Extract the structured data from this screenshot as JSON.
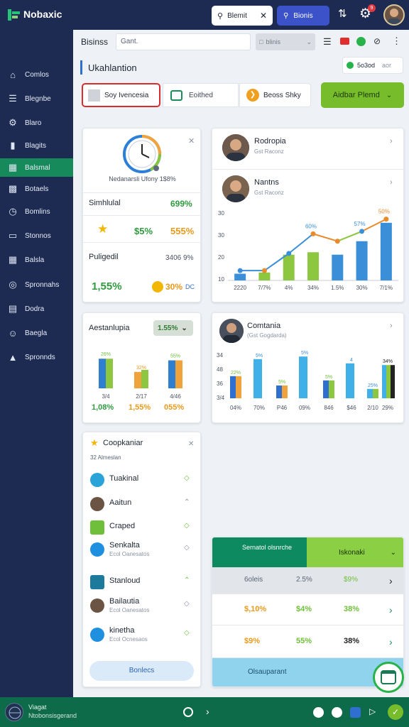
{
  "topbar": {
    "logo": "Nobaxic",
    "search_label": "Blemit",
    "blue_button": "Bionis",
    "notif_count": "9"
  },
  "sidebar": {
    "items": [
      {
        "label": "Comlos",
        "icon": "home-icon"
      },
      {
        "label": "Blegnbe",
        "icon": "menu-icon"
      },
      {
        "label": "Blaro",
        "icon": "gear-icon"
      },
      {
        "label": "Blagits",
        "icon": "chart-icon"
      },
      {
        "label": "Balsmal",
        "icon": "dashboard-icon"
      },
      {
        "label": "Botaels",
        "icon": "calendar-icon"
      },
      {
        "label": "Bomlins",
        "icon": "clock-icon"
      },
      {
        "label": "Stonnos",
        "icon": "book-icon"
      },
      {
        "label": "Balsla",
        "icon": "grid-icon"
      },
      {
        "label": "Spronnahs",
        "icon": "target-icon"
      },
      {
        "label": "Dodra",
        "icon": "doc-icon"
      },
      {
        "label": "Baegla",
        "icon": "person-icon"
      },
      {
        "label": "Spronnds",
        "icon": "hat-icon"
      }
    ]
  },
  "toolbar": {
    "title": "Bisinss",
    "search_placeholder": "Gant.",
    "dropdown_value": "blinis"
  },
  "section": {
    "title": "Ukahlantion",
    "pill_label": "5o3od",
    "pill_suffix": "aor",
    "chip1": "Soy Ivencesia",
    "chip2": "Eoithed",
    "chip3": "Beoss Shky",
    "primary_button": "Aidbar Plemd"
  },
  "card_summary": {
    "subtitle": "Nedanarsli Ufony 1$8%",
    "row1_label": "Simhlulal",
    "row1_value": "699%",
    "row2_value_a": "$5%",
    "row2_value_b": "555%",
    "row3_label": "Puligedil",
    "row3_value": "3406 9%",
    "row4_value_a": "1,55%",
    "row4_value_b": "30%",
    "row4_suffix": "DC"
  },
  "card_people": {
    "person1_name": "Rodropia",
    "person1_sub": "Gst Raconz",
    "person2_name": "Nantns",
    "person2_sub": "Gst Raconz"
  },
  "card_bars_small": {
    "title": "Aestanlupia",
    "badge": "1.55%",
    "footer": [
      "1,08%",
      "1,55%",
      "055%"
    ]
  },
  "card_comp": {
    "name": "Comtania",
    "sub": "(Gst Gogdarda)"
  },
  "card_list": {
    "title": "Coopkaniar",
    "subtitle": "32 Almeslan",
    "items": [
      {
        "name": "Tuakinal",
        "sub": "",
        "icon": "puzzle-icon"
      },
      {
        "name": "Aaitun",
        "sub": "",
        "icon": "avatar-icon"
      },
      {
        "name": "Craped",
        "sub": "",
        "icon": "document-icon"
      },
      {
        "name": "Senkalta",
        "sub": "Ecol Oanesatos",
        "icon": "globe-icon"
      },
      {
        "name": "Stanloud",
        "sub": "",
        "icon": "monitor-icon"
      },
      {
        "name": "Bailautia",
        "sub": "Ecol Oanesatos",
        "icon": "avatar-icon"
      },
      {
        "name": "kinetha",
        "sub": "Ecol Ocnesaos",
        "icon": "globe-icon"
      }
    ],
    "footer_button": "Bonlecs"
  },
  "table_card": {
    "header_left": "Sernatol olsnrche",
    "header_right": "Iskonaki",
    "rows": [
      [
        "6oleis",
        "2.5%",
        "$9%"
      ],
      [
        "$,10%",
        "$4%",
        "38%"
      ],
      [
        "$9%",
        "55%",
        "38%"
      ]
    ],
    "footer": "Olsauparant"
  },
  "bottombar": {
    "title": "Viagat",
    "subtitle": "Ntobonsisgerand"
  },
  "chart_data": [
    {
      "type": "bar",
      "name": "people-chart",
      "categories": [
        "2220",
        "7/7%",
        "4%",
        "34%",
        "1.5%",
        "30%",
        "7/1%"
      ],
      "series": [
        {
          "values": [
            5.5,
            6.5,
            21,
            23,
            21,
            32,
            47
          ]
        },
        {
          "values": [
            8,
            8,
            22,
            38,
            32,
            40,
            50
          ]
        }
      ],
      "yticks": [
        "30",
        "30",
        "20",
        "10"
      ],
      "data_labels": [
        "50%",
        "57%",
        "60%"
      ],
      "ylim": [
        0,
        55
      ]
    },
    {
      "type": "bar",
      "name": "small-bar-chart",
      "groups": [
        {
          "label": "26%",
          "values": [
            0.72,
            0.72
          ],
          "colors": [
            "#2f7fd0",
            "#8dc63f"
          ],
          "tick": "3/4"
        },
        {
          "label": "32%",
          "values": [
            0.4,
            0.45
          ],
          "colors": [
            "#f1a33b",
            "#8dc63f"
          ],
          "tick": "2/17"
        },
        {
          "label": "55%",
          "values": [
            0.68,
            0.68
          ],
          "colors": [
            "#2f7fd0",
            "#f1a33b"
          ],
          "tick": "4/46"
        }
      ]
    },
    {
      "type": "bar",
      "name": "comp-chart",
      "categories": [
        "04%",
        "70%",
        "P46",
        "09%",
        "846",
        "$46",
        "2/10",
        "29%"
      ],
      "yticks": [
        "34",
        "48",
        "36",
        "3/4"
      ],
      "data_labels": [
        "22%",
        "5%",
        "5%",
        "5%",
        "5%",
        "4",
        "25%",
        "34%"
      ]
    }
  ]
}
